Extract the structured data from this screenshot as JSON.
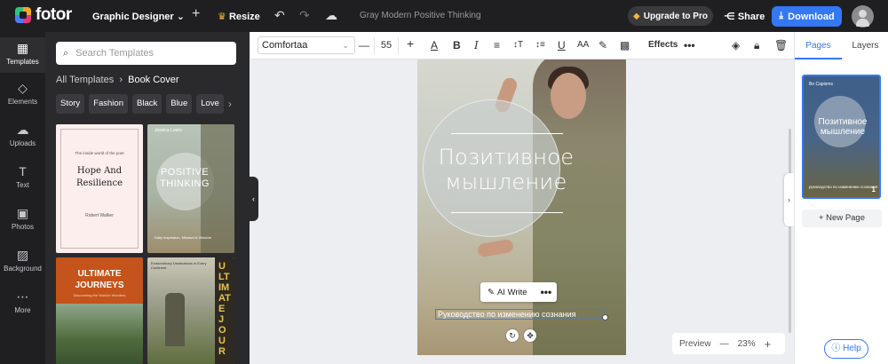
{
  "app": {
    "name": "fotor",
    "mode": "Graphic Designer",
    "doc_title": "Gray Modern Positive Thinking"
  },
  "topbar": {
    "add_symbol": "+",
    "resize": "Resize",
    "upgrade": "Upgrade to Pro",
    "share": "Share",
    "download": "Download"
  },
  "rail": [
    {
      "label": "Templates",
      "icon": "grid-icon",
      "glyph": "▦"
    },
    {
      "label": "Elements",
      "icon": "shapes-icon",
      "glyph": "◇"
    },
    {
      "label": "Uploads",
      "icon": "cloud-upload-icon",
      "glyph": "☁"
    },
    {
      "label": "Text",
      "icon": "text-icon",
      "glyph": "T"
    },
    {
      "label": "Photos",
      "icon": "image-icon",
      "glyph": "▣"
    },
    {
      "label": "Background",
      "icon": "background-icon",
      "glyph": "▨"
    },
    {
      "label": "More",
      "icon": "more-icon",
      "glyph": "⋯"
    }
  ],
  "panel": {
    "search_placeholder": "Search Templates",
    "breadcrumb_root": "All Templates",
    "breadcrumb_current": "Book Cover",
    "tags": [
      "Story",
      "Fashion",
      "Black",
      "Blue",
      "Love"
    ],
    "templates": [
      {
        "top": "The inside world of the poet",
        "title": "Hope And Resilience",
        "author": "Robert Walker"
      },
      {
        "top": "Jessica Lewis",
        "title": "POSITIVE THINKING",
        "sub": "Daily Inspiration, Mindset & Wisdom"
      },
      {
        "title": "ULTIMATE JOURNEYS",
        "sub": "Discovering the World's Wonders"
      },
      {
        "top": "Extraordinary Destinations in Every Continent",
        "title": "ULTIMATE JOUR"
      }
    ]
  },
  "toolbar": {
    "font": "Comfortaa",
    "font_size": "55",
    "minus": "—",
    "plus": "+",
    "effects": "Effects",
    "more": "•••"
  },
  "canvas": {
    "title": "Позитивное мышление",
    "subtitle": "Руководство по изменению сознания",
    "ai_write": "AI Write",
    "ai_more": "•••"
  },
  "zoom": {
    "preview": "Preview",
    "value": "23%",
    "minus": "—",
    "plus": "+"
  },
  "sidebar": {
    "tabs": [
      "Pages",
      "Layers"
    ],
    "thumb": {
      "small": "Bo Capisms",
      "title": "Позитивное мышление",
      "sub": "руководство по изменению сознания",
      "page": "1"
    },
    "new_page": "New Page"
  },
  "help": "Help",
  "colors": {
    "accent": "#3478f6",
    "dark": "#1f1f21",
    "panel": "#2a2a2d"
  }
}
